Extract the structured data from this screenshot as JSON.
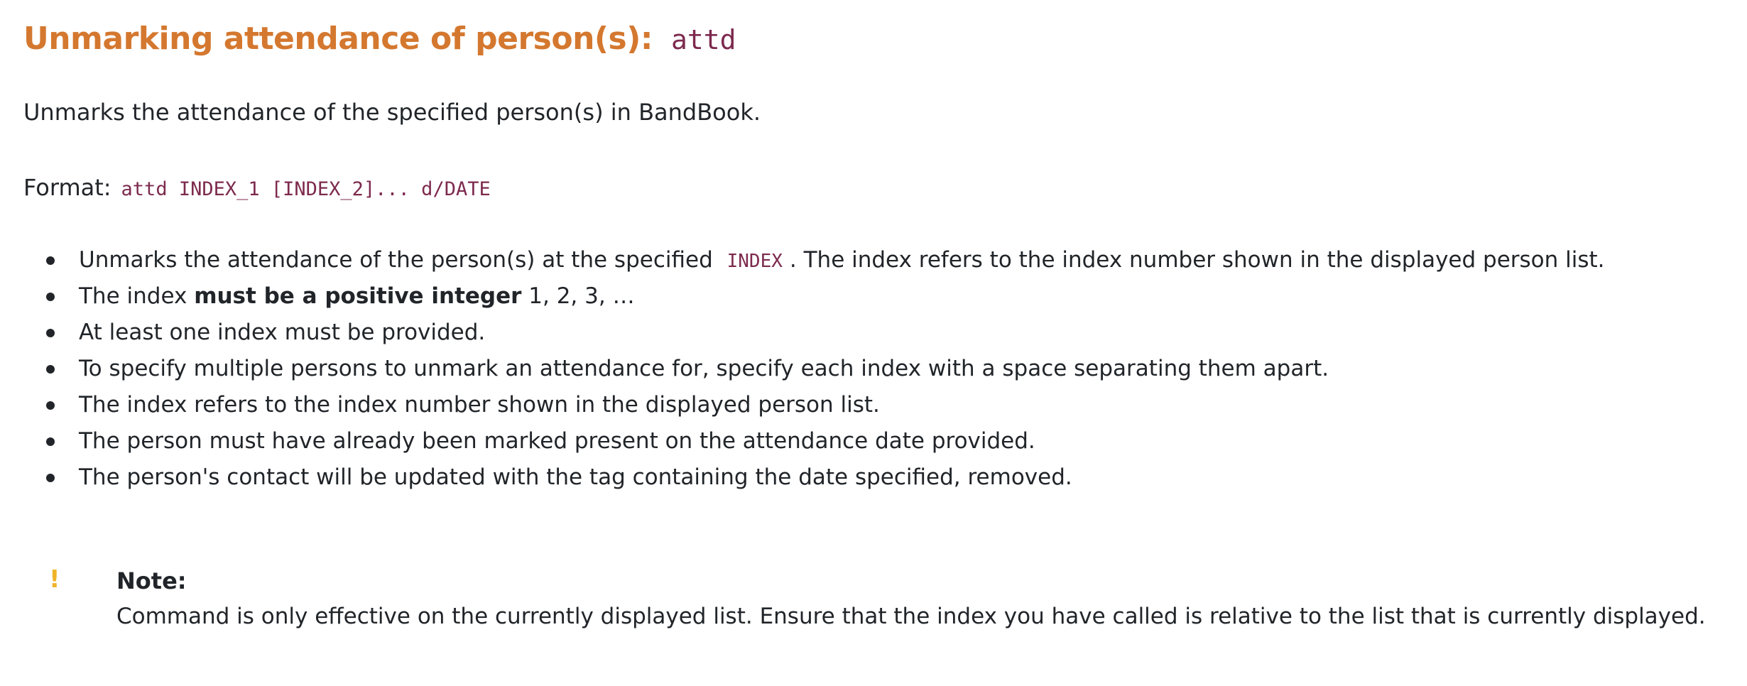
{
  "heading": {
    "title": "Unmarking attendance of person(s):",
    "command": "attd"
  },
  "description": "Unmarks the attendance of the specified person(s) in BandBook.",
  "format": {
    "label": "Format:",
    "syntax": "attd INDEX_1 [INDEX_2]... d/DATE"
  },
  "bullets": {
    "b0": {
      "before": "Unmarks the attendance of the person(s) at the specified",
      "code": "INDEX",
      "after": ". The index refers to the index number shown in the displayed person list."
    },
    "b1": {
      "before": "The index ",
      "bold": "must be a positive integer",
      "after": " 1, 2, 3, …"
    },
    "b2": "At least one index must be provided.",
    "b3": "To specify multiple persons to unmark an attendance for, specify each index with a space separating them apart.",
    "b4": "The index refers to the index number shown in the displayed person list.",
    "b5": "The person must have already been marked present on the attendance date provided.",
    "b6": "The person's contact will be updated with the tag containing the date specified, removed."
  },
  "note": {
    "icon": "exclamation-icon",
    "icon_symbol": "!",
    "icon_color": "#f0b429",
    "title": "Note:",
    "body": "Command is only effective on the currently displayed list. Ensure that the index you have called is relative to the list that is currently displayed."
  },
  "colors": {
    "heading": "#d4782f",
    "code": "#7d2a4e",
    "text": "#212529"
  }
}
